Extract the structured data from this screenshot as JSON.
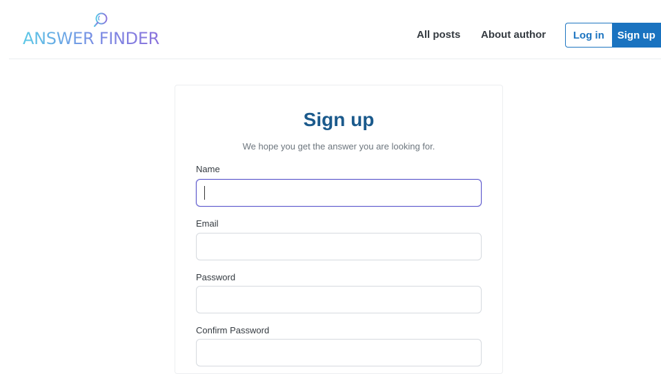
{
  "brand": {
    "logo_text": "ANSWER FINDER",
    "icon": "magnifier-icon"
  },
  "nav": {
    "all_posts": "All posts",
    "about_author": "About author",
    "login": "Log in",
    "signup": "Sign up"
  },
  "form": {
    "title": "Sign up",
    "subtitle": "We hope you get the answer you are looking for.",
    "fields": [
      {
        "label": "Name",
        "value": "",
        "focused": true
      },
      {
        "label": "Email",
        "value": ""
      },
      {
        "label": "Password",
        "value": ""
      },
      {
        "label": "Confirm Password",
        "value": ""
      }
    ]
  },
  "colors": {
    "primary": "#1a73c0",
    "title": "#1b5a8c",
    "focus_border": "#5a55cc",
    "logo_gradient": [
      "#5bc8e6",
      "#8b72dc"
    ]
  }
}
